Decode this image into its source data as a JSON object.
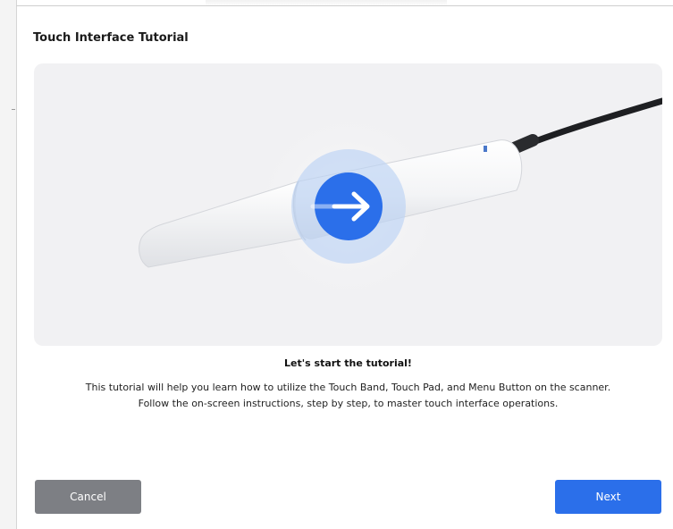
{
  "dialog": {
    "title": "Touch Interface Tutorial"
  },
  "hero": {
    "device": "intraoral-scanner",
    "overlay_icon": "arrow-right-icon",
    "accent_color": "#2b6fea"
  },
  "content": {
    "heading": "Let's start the tutorial!",
    "description_line1": "This tutorial will help you learn how to utilize the Touch Band, Touch Pad, and Menu Button on the scanner.",
    "description_line2": "Follow the on-screen instructions, step by step, to master touch interface operations."
  },
  "actions": {
    "cancel_label": "Cancel",
    "next_label": "Next",
    "cancel_color": "#7d7f84",
    "next_color": "#2b6fea"
  }
}
